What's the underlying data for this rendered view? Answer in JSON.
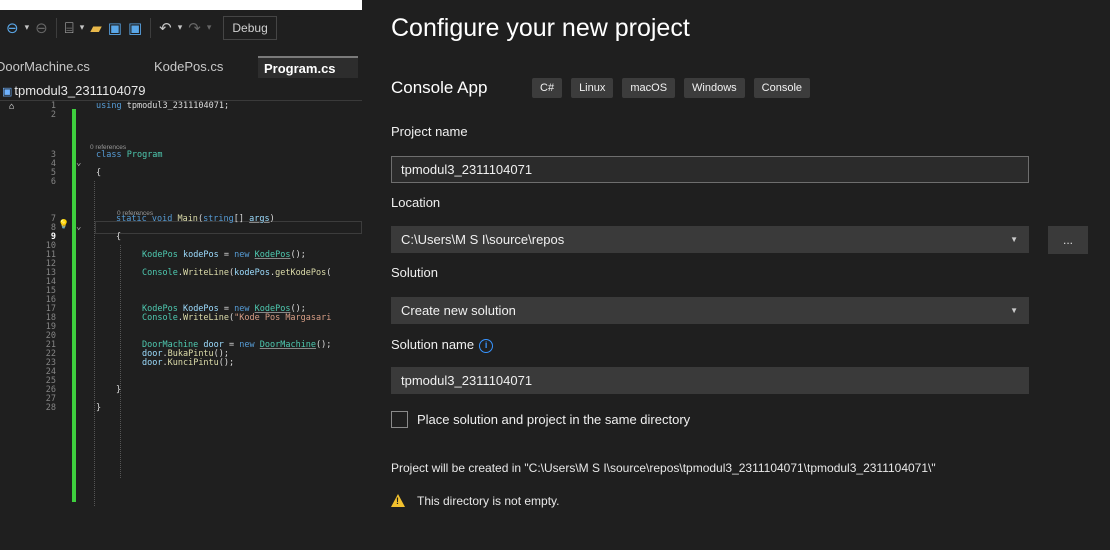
{
  "ide": {
    "toolbar": {
      "debug_label": "Debug"
    },
    "tabs": [
      "DoorMachine.cs",
      "KodePos.cs",
      "Program.cs"
    ],
    "project_name": "tpmodul3_2311104079",
    "code_lines": [
      {
        "n": "1",
        "html": "<span class='kw'>using</span> tpmodul3_2311104071;"
      },
      {
        "n": "2",
        "html": ""
      },
      {
        "n": "3",
        "html": "<span class='kw'>class</span> <span class='ty'>Program</span>"
      },
      {
        "n": "4",
        "html": ""
      },
      {
        "n": "5",
        "html": "{"
      },
      {
        "n": "6",
        "html": ""
      },
      {
        "n": "7",
        "html": "<span class='kw'>static</span> <span class='kw'>void</span> <span class='fn'>Main</span>(<span class='kw'>string</span>[] <span class='vr ul'>args</span>)"
      },
      {
        "n": "8",
        "html": ""
      },
      {
        "n": "9",
        "html": "{"
      },
      {
        "n": "10",
        "html": ""
      },
      {
        "n": "11",
        "html": "<span class='ty'>KodePos</span> <span class='vr'>kodePos</span> = <span class='kw'>new</span> <span class='ty ul'>KodePos</span>();"
      },
      {
        "n": "12",
        "html": ""
      },
      {
        "n": "13",
        "html": "<span class='ty'>Console</span>.<span class='fn'>WriteLine</span>(<span class='vr'>kodePos</span>.<span class='fn'>getKodePos</span>("
      },
      {
        "n": "14",
        "html": ""
      },
      {
        "n": "15",
        "html": ""
      },
      {
        "n": "16",
        "html": ""
      },
      {
        "n": "17",
        "html": "<span class='ty'>KodePos</span> <span class='vr'>KodePos</span> = <span class='kw'>new</span> <span class='ty ul'>KodePos</span>();"
      },
      {
        "n": "18",
        "html": "<span class='ty'>Console</span>.<span class='fn'>WriteLine</span>(<span class='st'>\"Kode Pos Margasari</span>"
      },
      {
        "n": "19",
        "html": ""
      },
      {
        "n": "20",
        "html": ""
      },
      {
        "n": "21",
        "html": "<span class='ty'>DoorMachine</span> <span class='vr'>door</span> = <span class='kw'>new</span> <span class='ty ul'>DoorMachine</span>();"
      },
      {
        "n": "22",
        "html": "<span class='vr'>door</span>.<span class='fn'>BukaPintu</span>();"
      },
      {
        "n": "23",
        "html": "<span class='vr'>door</span>.<span class='fn'>KunciPintu</span>();"
      },
      {
        "n": "24",
        "html": ""
      },
      {
        "n": "25",
        "html": ""
      },
      {
        "n": "26",
        "html": "}"
      },
      {
        "n": "27",
        "html": ""
      },
      {
        "n": "28",
        "html": "}"
      }
    ],
    "references_label": "0 references"
  },
  "dialog": {
    "title": "Configure your new project",
    "template_name": "Console App",
    "tags": [
      "C#",
      "Linux",
      "macOS",
      "Windows",
      "Console"
    ],
    "project_name_label": "Project name",
    "project_name_value": "tpmodul3_2311104071",
    "location_label": "Location",
    "location_value": "C:\\Users\\M S I\\source\\repos",
    "browse_label": "...",
    "solution_label": "Solution",
    "solution_value": "Create new solution",
    "solution_name_label": "Solution name",
    "solution_name_value": "tpmodul3_2311104071",
    "same_dir_label": "Place solution and project in the same directory",
    "same_dir_checked": false,
    "created_in_text": "Project will be created in \"C:\\Users\\M S I\\source\\repos\\tpmodul3_2311104071\\tpmodul3_2311104071\\\"",
    "warning_text": "This directory is not empty."
  }
}
